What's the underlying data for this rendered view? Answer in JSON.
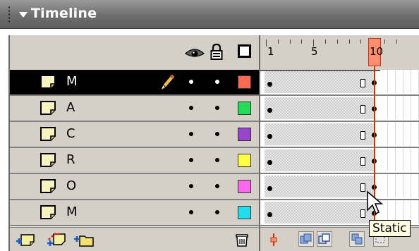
{
  "panel": {
    "title": "Timeline"
  },
  "header": {
    "icons": [
      "eye-icon",
      "lock-icon",
      "outline-icon"
    ],
    "ruler_labels": [
      "1",
      "5",
      "10"
    ],
    "current_frame": "10"
  },
  "layers": [
    {
      "name": "M",
      "selected": true,
      "editing": true,
      "color": "#ff6a4f",
      "keyframes": [
        "1",
        "10"
      ]
    },
    {
      "name": "A",
      "selected": false,
      "editing": false,
      "color": "#22dd55",
      "keyframes": [
        "1",
        "10"
      ]
    },
    {
      "name": "C",
      "selected": false,
      "editing": false,
      "color": "#9944cc",
      "keyframes": [
        "1",
        "10"
      ]
    },
    {
      "name": "R",
      "selected": false,
      "editing": false,
      "color": "#ffff44",
      "keyframes": [
        "1",
        "10"
      ]
    },
    {
      "name": "O",
      "selected": false,
      "editing": false,
      "color": "#ff66ee",
      "keyframes": [
        "1",
        "10"
      ]
    },
    {
      "name": "M",
      "selected": false,
      "editing": false,
      "color": "#22ddee",
      "keyframes": [
        "1",
        "10"
      ]
    }
  ],
  "footer": {
    "layer_buttons": [
      "insert-layer-icon",
      "add-motion-guide-icon",
      "insert-folder-icon",
      "trash-icon"
    ],
    "timeline_buttons": [
      "center-frame-icon",
      "onion-skin-icon",
      "onion-skin-outlines-icon",
      "edit-multiple-frames-icon",
      "modify-onion-markers-icon"
    ]
  },
  "tooltip": "Static"
}
